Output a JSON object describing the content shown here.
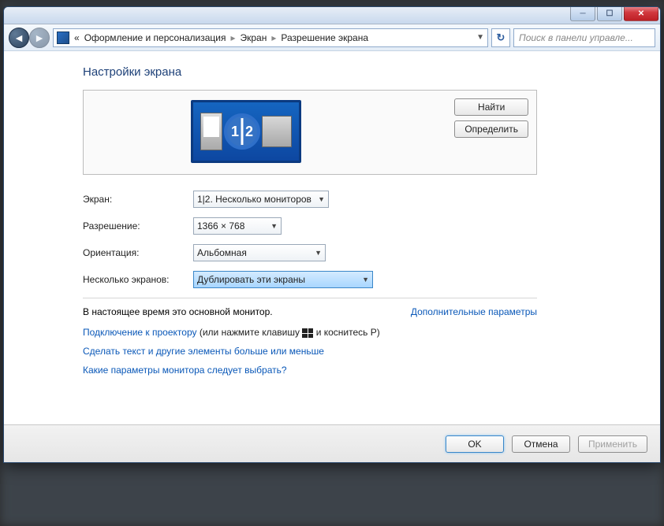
{
  "breadcrumb": {
    "level1": "Оформление и персонализация",
    "level2": "Экран",
    "level3": "Разрешение экрана"
  },
  "search": {
    "placeholder": "Поиск в панели управле..."
  },
  "heading": "Настройки экрана",
  "preview_buttons": {
    "find": "Найти",
    "identify": "Определить"
  },
  "monitor_numbers": {
    "a": "1",
    "b": "2"
  },
  "fields": {
    "screen": {
      "label": "Экран:",
      "value": "1|2. Несколько мониторов"
    },
    "resolution": {
      "label": "Разрешение:",
      "value": "1366 × 768"
    },
    "orientation": {
      "label": "Ориентация:",
      "value": "Альбомная"
    },
    "multi": {
      "label": "Несколько экранов:",
      "value": "Дублировать эти экраны"
    }
  },
  "primary_text": "В настоящее время это основной монитор.",
  "adv_link": "Дополнительные параметры",
  "projector": {
    "link": "Подключение к проектору",
    "text1": "(или нажмите клавишу",
    "text2": "и коснитесь P)"
  },
  "size_link": "Сделать текст и другие элементы больше или меньше",
  "which_link": "Какие параметры монитора следует выбрать?",
  "footer": {
    "ok": "OK",
    "cancel": "Отмена",
    "apply": "Применить"
  }
}
